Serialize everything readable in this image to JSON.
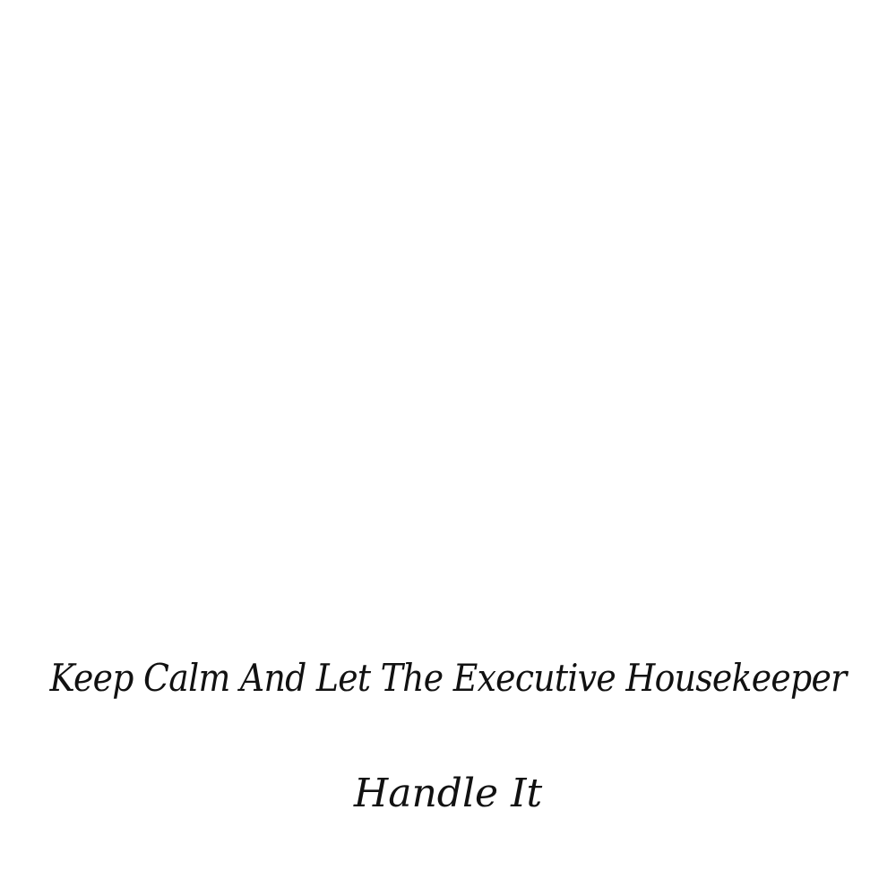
{
  "quote": {
    "line1": "Keep Calm And Let The Executive Housekeeper",
    "line2": "Handle It"
  },
  "colors": {
    "background": "#ffffff",
    "text": "#111111"
  }
}
